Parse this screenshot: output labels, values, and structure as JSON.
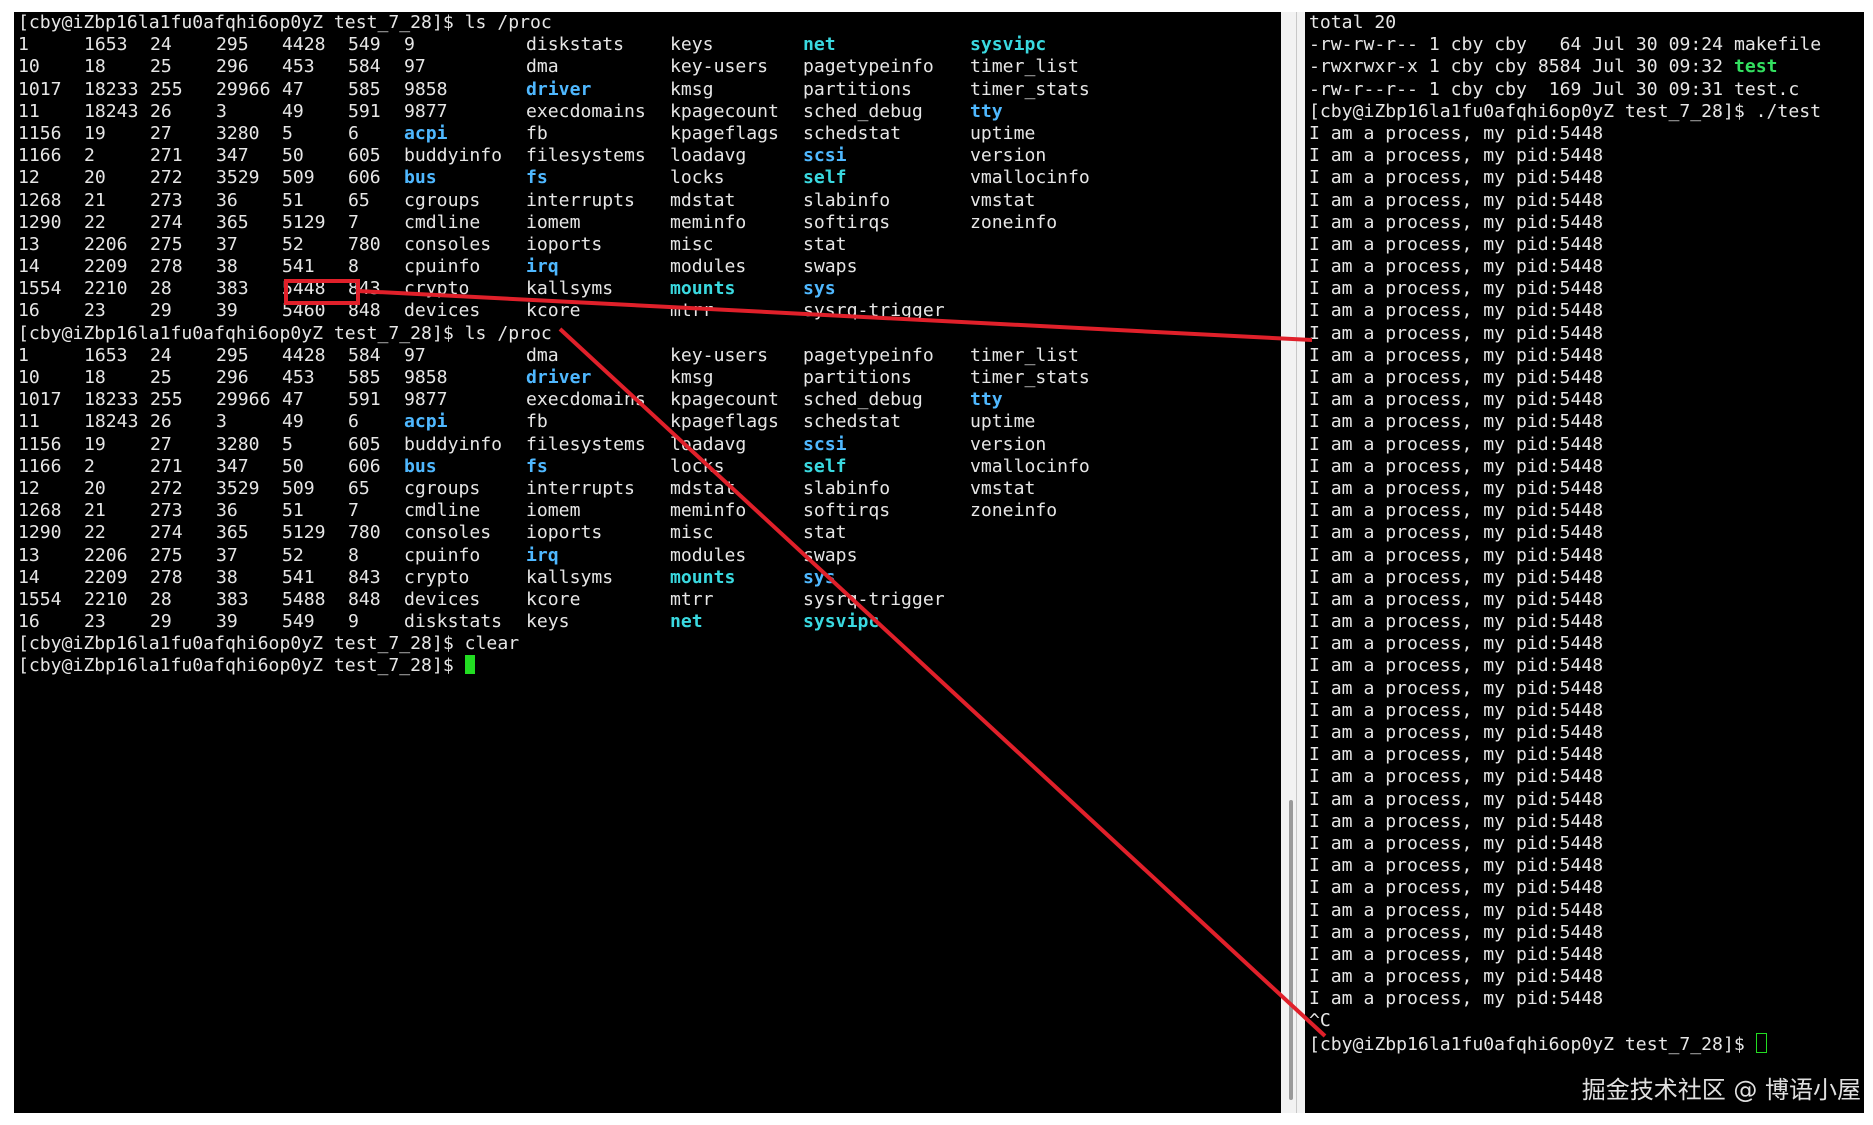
{
  "left_terminal": {
    "prompt": "[cby@iZbp16la1fu0afqhi6op0yZ test_7_28]$ ",
    "command_1": "ls /proc",
    "listing_1": [
      [
        [
          "1",
          "n"
        ],
        [
          "1653",
          "n"
        ],
        [
          "24",
          "n"
        ],
        [
          "295",
          "n"
        ],
        [
          "4428",
          "n"
        ],
        [
          "549",
          "n"
        ],
        [
          "9",
          "n"
        ],
        [
          "diskstats",
          "n"
        ],
        [
          "keys",
          "n"
        ],
        [
          "net",
          "cy"
        ],
        [
          "sysvipc",
          "cy"
        ]
      ],
      [
        [
          "10",
          "n"
        ],
        [
          "18",
          "n"
        ],
        [
          "25",
          "n"
        ],
        [
          "296",
          "n"
        ],
        [
          "453",
          "n"
        ],
        [
          "584",
          "n"
        ],
        [
          "97",
          "n"
        ],
        [
          "dma",
          "n"
        ],
        [
          "key-users",
          "n"
        ],
        [
          "pagetypeinfo",
          "n"
        ],
        [
          "timer_list",
          "n"
        ]
      ],
      [
        [
          "1017",
          "n"
        ],
        [
          "18233",
          "n"
        ],
        [
          "255",
          "n"
        ],
        [
          "29966",
          "n"
        ],
        [
          "47",
          "n"
        ],
        [
          "585",
          "n"
        ],
        [
          "9858",
          "n"
        ],
        [
          "driver",
          "dir"
        ],
        [
          "kmsg",
          "n"
        ],
        [
          "partitions",
          "n"
        ],
        [
          "timer_stats",
          "n"
        ]
      ],
      [
        [
          "11",
          "n"
        ],
        [
          "18243",
          "n"
        ],
        [
          "26",
          "n"
        ],
        [
          "3",
          "n"
        ],
        [
          "49",
          "n"
        ],
        [
          "591",
          "n"
        ],
        [
          "9877",
          "n"
        ],
        [
          "execdomains",
          "n"
        ],
        [
          "kpagecount",
          "n"
        ],
        [
          "sched_debug",
          "n"
        ],
        [
          "tty",
          "dir"
        ]
      ],
      [
        [
          "1156",
          "n"
        ],
        [
          "19",
          "n"
        ],
        [
          "27",
          "n"
        ],
        [
          "3280",
          "n"
        ],
        [
          "5",
          "n"
        ],
        [
          "6",
          "n"
        ],
        [
          "acpi",
          "dir"
        ],
        [
          "fb",
          "n"
        ],
        [
          "kpageflags",
          "n"
        ],
        [
          "schedstat",
          "n"
        ],
        [
          "uptime",
          "n"
        ]
      ],
      [
        [
          "1166",
          "n"
        ],
        [
          "2",
          "n"
        ],
        [
          "271",
          "n"
        ],
        [
          "347",
          "n"
        ],
        [
          "50",
          "n"
        ],
        [
          "605",
          "n"
        ],
        [
          "buddyinfo",
          "n"
        ],
        [
          "filesystems",
          "n"
        ],
        [
          "loadavg",
          "n"
        ],
        [
          "scsi",
          "dir"
        ],
        [
          "version",
          "n"
        ]
      ],
      [
        [
          "12",
          "n"
        ],
        [
          "20",
          "n"
        ],
        [
          "272",
          "n"
        ],
        [
          "3529",
          "n"
        ],
        [
          "509",
          "n"
        ],
        [
          "606",
          "n"
        ],
        [
          "bus",
          "dir"
        ],
        [
          "fs",
          "dir"
        ],
        [
          "locks",
          "n"
        ],
        [
          "self",
          "cy"
        ],
        [
          "vmallocinfo",
          "n"
        ]
      ],
      [
        [
          "1268",
          "n"
        ],
        [
          "21",
          "n"
        ],
        [
          "273",
          "n"
        ],
        [
          "36",
          "n"
        ],
        [
          "51",
          "n"
        ],
        [
          "65",
          "n"
        ],
        [
          "cgroups",
          "n"
        ],
        [
          "interrupts",
          "n"
        ],
        [
          "mdstat",
          "n"
        ],
        [
          "slabinfo",
          "n"
        ],
        [
          "vmstat",
          "n"
        ]
      ],
      [
        [
          "1290",
          "n"
        ],
        [
          "22",
          "n"
        ],
        [
          "274",
          "n"
        ],
        [
          "365",
          "n"
        ],
        [
          "5129",
          "n"
        ],
        [
          "7",
          "n"
        ],
        [
          "cmdline",
          "n"
        ],
        [
          "iomem",
          "n"
        ],
        [
          "meminfo",
          "n"
        ],
        [
          "softirqs",
          "n"
        ],
        [
          "zoneinfo",
          "n"
        ]
      ],
      [
        [
          "13",
          "n"
        ],
        [
          "2206",
          "n"
        ],
        [
          "275",
          "n"
        ],
        [
          "37",
          "n"
        ],
        [
          "52",
          "n"
        ],
        [
          "780",
          "n"
        ],
        [
          "consoles",
          "n"
        ],
        [
          "ioports",
          "n"
        ],
        [
          "misc",
          "n"
        ],
        [
          "stat",
          "n"
        ],
        [
          "",
          "n"
        ]
      ],
      [
        [
          "14",
          "n"
        ],
        [
          "2209",
          "n"
        ],
        [
          "278",
          "n"
        ],
        [
          "38",
          "n"
        ],
        [
          "541",
          "n"
        ],
        [
          "8",
          "n"
        ],
        [
          "cpuinfo",
          "n"
        ],
        [
          "irq",
          "dir"
        ],
        [
          "modules",
          "n"
        ],
        [
          "swaps",
          "n"
        ],
        [
          "",
          "n"
        ]
      ],
      [
        [
          "1554",
          "n"
        ],
        [
          "2210",
          "n"
        ],
        [
          "28",
          "n"
        ],
        [
          "383",
          "n"
        ],
        [
          "5448",
          "n"
        ],
        [
          "843",
          "n"
        ],
        [
          "crypto",
          "n"
        ],
        [
          "kallsyms",
          "n"
        ],
        [
          "mounts",
          "cy"
        ],
        [
          "sys",
          "dir"
        ],
        [
          "",
          "n"
        ]
      ],
      [
        [
          "16",
          "n"
        ],
        [
          "23",
          "n"
        ],
        [
          "29",
          "n"
        ],
        [
          "39",
          "n"
        ],
        [
          "5460",
          "n"
        ],
        [
          "848",
          "n"
        ],
        [
          "devices",
          "n"
        ],
        [
          "kcore",
          "n"
        ],
        [
          "mtrr",
          "n"
        ],
        [
          "sysrq-trigger",
          "n"
        ],
        [
          "",
          "n"
        ]
      ]
    ],
    "command_2": "ls /proc",
    "listing_2": [
      [
        [
          "1",
          "n"
        ],
        [
          "1653",
          "n"
        ],
        [
          "24",
          "n"
        ],
        [
          "295",
          "n"
        ],
        [
          "4428",
          "n"
        ],
        [
          "584",
          "n"
        ],
        [
          "97",
          "n"
        ],
        [
          "dma",
          "n"
        ],
        [
          "key-users",
          "n"
        ],
        [
          "pagetypeinfo",
          "n"
        ],
        [
          "timer_list",
          "n"
        ]
      ],
      [
        [
          "10",
          "n"
        ],
        [
          "18",
          "n"
        ],
        [
          "25",
          "n"
        ],
        [
          "296",
          "n"
        ],
        [
          "453",
          "n"
        ],
        [
          "585",
          "n"
        ],
        [
          "9858",
          "n"
        ],
        [
          "driver",
          "dir"
        ],
        [
          "kmsg",
          "n"
        ],
        [
          "partitions",
          "n"
        ],
        [
          "timer_stats",
          "n"
        ]
      ],
      [
        [
          "1017",
          "n"
        ],
        [
          "18233",
          "n"
        ],
        [
          "255",
          "n"
        ],
        [
          "29966",
          "n"
        ],
        [
          "47",
          "n"
        ],
        [
          "591",
          "n"
        ],
        [
          "9877",
          "n"
        ],
        [
          "execdomains",
          "n"
        ],
        [
          "kpagecount",
          "n"
        ],
        [
          "sched_debug",
          "n"
        ],
        [
          "tty",
          "dir"
        ]
      ],
      [
        [
          "11",
          "n"
        ],
        [
          "18243",
          "n"
        ],
        [
          "26",
          "n"
        ],
        [
          "3",
          "n"
        ],
        [
          "49",
          "n"
        ],
        [
          "6",
          "n"
        ],
        [
          "acpi",
          "dir"
        ],
        [
          "fb",
          "n"
        ],
        [
          "kpageflags",
          "n"
        ],
        [
          "schedstat",
          "n"
        ],
        [
          "uptime",
          "n"
        ]
      ],
      [
        [
          "1156",
          "n"
        ],
        [
          "19",
          "n"
        ],
        [
          "27",
          "n"
        ],
        [
          "3280",
          "n"
        ],
        [
          "5",
          "n"
        ],
        [
          "605",
          "n"
        ],
        [
          "buddyinfo",
          "n"
        ],
        [
          "filesystems",
          "n"
        ],
        [
          "loadavg",
          "n"
        ],
        [
          "scsi",
          "dir"
        ],
        [
          "version",
          "n"
        ]
      ],
      [
        [
          "1166",
          "n"
        ],
        [
          "2",
          "n"
        ],
        [
          "271",
          "n"
        ],
        [
          "347",
          "n"
        ],
        [
          "50",
          "n"
        ],
        [
          "606",
          "n"
        ],
        [
          "bus",
          "dir"
        ],
        [
          "fs",
          "dir"
        ],
        [
          "locks",
          "n"
        ],
        [
          "self",
          "cy"
        ],
        [
          "vmallocinfo",
          "n"
        ]
      ],
      [
        [
          "12",
          "n"
        ],
        [
          "20",
          "n"
        ],
        [
          "272",
          "n"
        ],
        [
          "3529",
          "n"
        ],
        [
          "509",
          "n"
        ],
        [
          "65",
          "n"
        ],
        [
          "cgroups",
          "n"
        ],
        [
          "interrupts",
          "n"
        ],
        [
          "mdstat",
          "n"
        ],
        [
          "slabinfo",
          "n"
        ],
        [
          "vmstat",
          "n"
        ]
      ],
      [
        [
          "1268",
          "n"
        ],
        [
          "21",
          "n"
        ],
        [
          "273",
          "n"
        ],
        [
          "36",
          "n"
        ],
        [
          "51",
          "n"
        ],
        [
          "7",
          "n"
        ],
        [
          "cmdline",
          "n"
        ],
        [
          "iomem",
          "n"
        ],
        [
          "meminfo",
          "n"
        ],
        [
          "softirqs",
          "n"
        ],
        [
          "zoneinfo",
          "n"
        ]
      ],
      [
        [
          "1290",
          "n"
        ],
        [
          "22",
          "n"
        ],
        [
          "274",
          "n"
        ],
        [
          "365",
          "n"
        ],
        [
          "5129",
          "n"
        ],
        [
          "780",
          "n"
        ],
        [
          "consoles",
          "n"
        ],
        [
          "ioports",
          "n"
        ],
        [
          "misc",
          "n"
        ],
        [
          "stat",
          "n"
        ],
        [
          "",
          "n"
        ]
      ],
      [
        [
          "13",
          "n"
        ],
        [
          "2206",
          "n"
        ],
        [
          "275",
          "n"
        ],
        [
          "37",
          "n"
        ],
        [
          "52",
          "n"
        ],
        [
          "8",
          "n"
        ],
        [
          "cpuinfo",
          "n"
        ],
        [
          "irq",
          "dir"
        ],
        [
          "modules",
          "n"
        ],
        [
          "swaps",
          "n"
        ],
        [
          "",
          "n"
        ]
      ],
      [
        [
          "14",
          "n"
        ],
        [
          "2209",
          "n"
        ],
        [
          "278",
          "n"
        ],
        [
          "38",
          "n"
        ],
        [
          "541",
          "n"
        ],
        [
          "843",
          "n"
        ],
        [
          "crypto",
          "n"
        ],
        [
          "kallsyms",
          "n"
        ],
        [
          "mounts",
          "cy"
        ],
        [
          "sys",
          "dir"
        ],
        [
          "",
          "n"
        ]
      ],
      [
        [
          "1554",
          "n"
        ],
        [
          "2210",
          "n"
        ],
        [
          "28",
          "n"
        ],
        [
          "383",
          "n"
        ],
        [
          "5488",
          "n"
        ],
        [
          "848",
          "n"
        ],
        [
          "devices",
          "n"
        ],
        [
          "kcore",
          "n"
        ],
        [
          "mtrr",
          "n"
        ],
        [
          "sysrq-trigger",
          "n"
        ],
        [
          "",
          "n"
        ]
      ],
      [
        [
          "16",
          "n"
        ],
        [
          "23",
          "n"
        ],
        [
          "29",
          "n"
        ],
        [
          "39",
          "n"
        ],
        [
          "549",
          "n"
        ],
        [
          "9",
          "n"
        ],
        [
          "diskstats",
          "n"
        ],
        [
          "keys",
          "n"
        ],
        [
          "net",
          "cy"
        ],
        [
          "sysvipc",
          "cy"
        ],
        [
          "",
          "n"
        ]
      ]
    ],
    "command_3": "clear"
  },
  "right_terminal": {
    "total_line": "total 20",
    "files": [
      {
        "perms": "-rw-rw-r--",
        "links": "1",
        "owner": "cby",
        "group": "cby",
        "size": "  64",
        "date": "Jul 30 09:24",
        "name": "makefile",
        "exec": false
      },
      {
        "perms": "-rwxrwxr-x",
        "links": "1",
        "owner": "cby",
        "group": "cby",
        "size": "8584",
        "date": "Jul 30 09:32",
        "name": "test",
        "exec": true
      },
      {
        "perms": "-rw-r--r--",
        "links": "1",
        "owner": "cby",
        "group": "cby",
        "size": " 169",
        "date": "Jul 30 09:31",
        "name": "test.c",
        "exec": false
      }
    ],
    "prompt": "[cby@iZbp16la1fu0afqhi6op0yZ test_7_28]$ ",
    "run_command": "./test",
    "output_line": "I am a process, my pid:5448",
    "output_count": 40,
    "interrupt": "^C"
  },
  "annotation": {
    "highlighted_pid": "5448",
    "color": "#e0202a"
  },
  "watermark": "掘金技术社区 @ 博语小屋",
  "colors": {
    "background": "#000000",
    "text": "#e6e6e6",
    "directory": "#4fb8ff",
    "special": "#3ad9e0",
    "executable": "#33e060",
    "cursor": "#22dd22"
  }
}
